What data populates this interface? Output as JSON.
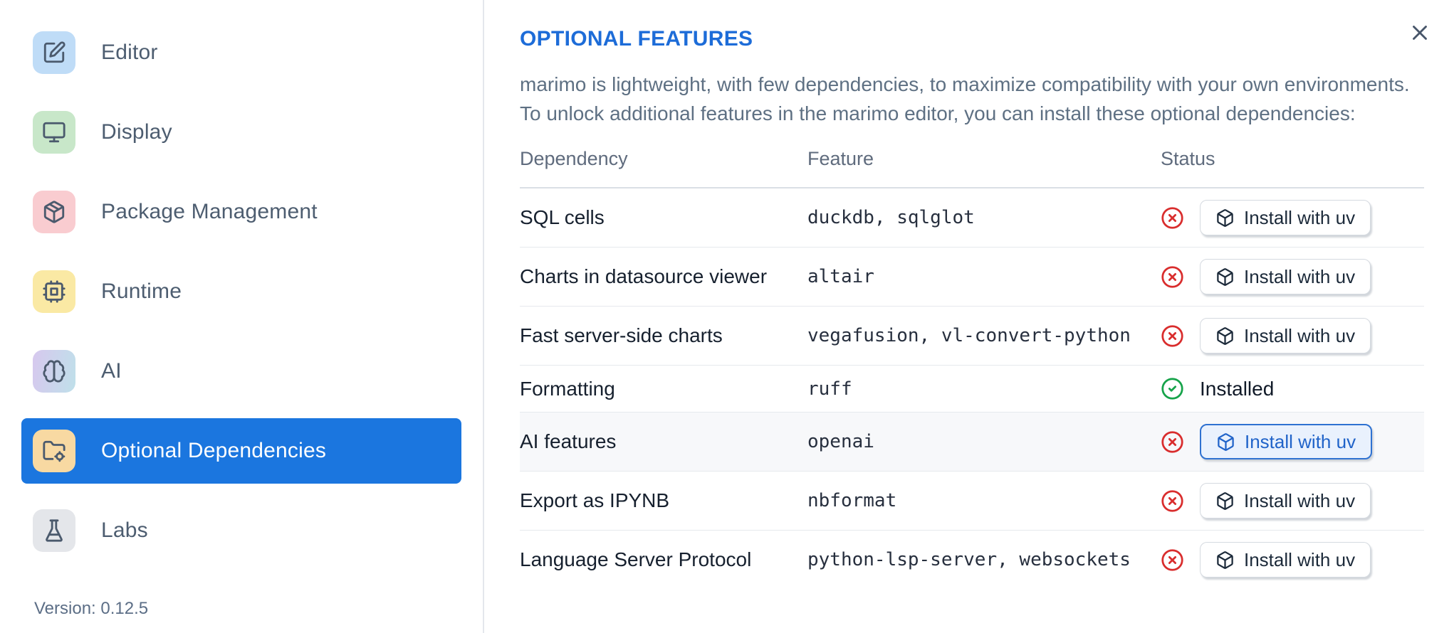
{
  "sidebar": {
    "items": [
      {
        "label": "Editor",
        "icon": "edit-icon",
        "tile_color": "#bfdcf7"
      },
      {
        "label": "Display",
        "icon": "monitor-icon",
        "tile_color": "#c8e7c9"
      },
      {
        "label": "Package Management",
        "icon": "package-icon",
        "tile_color": "#f9ccd0"
      },
      {
        "label": "Runtime",
        "icon": "cpu-icon",
        "tile_color": "#fae9a4"
      },
      {
        "label": "AI",
        "icon": "brain-icon",
        "tile_color": "linear-gradient(100deg,#d7c8ee,#bfe0ea)"
      },
      {
        "label": "Optional Dependencies",
        "icon": "folder-cog-icon",
        "tile_color": "#f8d9a2",
        "selected": true
      },
      {
        "label": "Labs",
        "icon": "flask-icon",
        "tile_color": "#e4e6ea"
      }
    ],
    "version_label": "Version: 0.12.5",
    "selected_color": "#1b76df"
  },
  "main": {
    "title": "OPTIONAL FEATURES",
    "description_line1": "marimo is lightweight, with few dependencies, to maximize compatibility with your own environments.",
    "description_line2": "To unlock additional features in the marimo editor, you can install these optional dependencies:",
    "table": {
      "columns": [
        "Dependency",
        "Feature",
        "Status"
      ],
      "rows": [
        {
          "dependency": "SQL cells",
          "feature": "duckdb, sqlglot",
          "installed": false,
          "action": "Install with uv"
        },
        {
          "dependency": "Charts in datasource viewer",
          "feature": "altair",
          "installed": false,
          "action": "Install with uv"
        },
        {
          "dependency": "Fast server-side charts",
          "feature": "vegafusion, vl-convert-python",
          "installed": false,
          "action": "Install with uv"
        },
        {
          "dependency": "Formatting",
          "feature": "ruff",
          "installed": true,
          "status_label": "Installed"
        },
        {
          "dependency": "AI features",
          "feature": "openai",
          "installed": false,
          "action": "Install with uv",
          "highlighted_row": true,
          "button_focused": true
        },
        {
          "dependency": "Export as IPYNB",
          "feature": "nbformat",
          "installed": false,
          "action": "Install with uv"
        },
        {
          "dependency": "Language Server Protocol",
          "feature": "python-lsp-server, websockets",
          "installed": false,
          "action": "Install with uv"
        }
      ]
    },
    "colors": {
      "accent_blue": "#1b76df",
      "title_blue": "#1d6cd8",
      "status_missing_red": "#d92d2d",
      "status_installed_green": "#16a34a",
      "focused_button_border": "#2e71d1",
      "highlighted_row_bg": "#f7f8fa"
    }
  },
  "dialog": {
    "close_label": "close"
  }
}
